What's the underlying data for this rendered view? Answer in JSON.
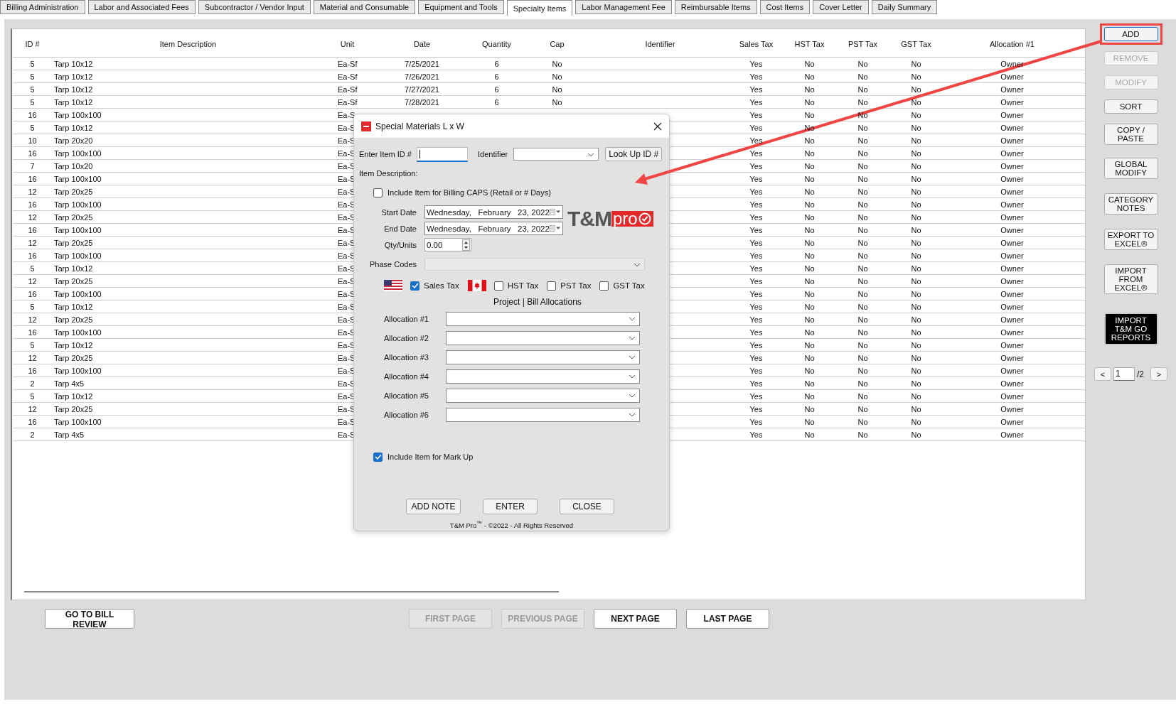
{
  "tabs": [
    {
      "label": "Billing Administration",
      "selected": false
    },
    {
      "label": "Labor and Associated Fees",
      "selected": false
    },
    {
      "label": "Subcontractor / Vendor Input",
      "selected": false
    },
    {
      "label": "Material and Consumable",
      "selected": false
    },
    {
      "label": "Equipment and Tools",
      "selected": false
    },
    {
      "label": "Specialty Items",
      "selected": true
    },
    {
      "label": "Labor Management Fee",
      "selected": false
    },
    {
      "label": "Reimbursable Items",
      "selected": false
    },
    {
      "label": "Cost Items",
      "selected": false
    },
    {
      "label": "Cover Letter",
      "selected": false
    },
    {
      "label": "Daily Summary",
      "selected": false
    }
  ],
  "table": {
    "columns": [
      "ID #",
      "Item Description",
      "Unit",
      "Date",
      "Quantity",
      "Cap",
      "Identifier",
      "Sales Tax",
      "HST Tax",
      "PST Tax",
      "GST Tax",
      "Allocation #1"
    ],
    "rows": [
      {
        "id": "5",
        "description": "Tarp 10x12",
        "unit": "Ea-Sf",
        "date": "7/25/2021",
        "quantity": "6",
        "cap": "No",
        "sales_tax": "Yes",
        "hst_tax": "No",
        "pst_tax": "No",
        "gst_tax": "No",
        "allocation_1": "Owner"
      },
      {
        "id": "5",
        "description": "Tarp 10x12",
        "unit": "Ea-Sf",
        "date": "7/26/2021",
        "quantity": "6",
        "cap": "No",
        "sales_tax": "Yes",
        "hst_tax": "No",
        "pst_tax": "No",
        "gst_tax": "No",
        "allocation_1": "Owner"
      },
      {
        "id": "5",
        "description": "Tarp 10x12",
        "unit": "Ea-Sf",
        "date": "7/27/2021",
        "quantity": "6",
        "cap": "No",
        "sales_tax": "Yes",
        "hst_tax": "No",
        "pst_tax": "No",
        "gst_tax": "No",
        "allocation_1": "Owner"
      },
      {
        "id": "5",
        "description": "Tarp 10x12",
        "unit": "Ea-Sf",
        "date": "7/28/2021",
        "quantity": "6",
        "cap": "No",
        "sales_tax": "Yes",
        "hst_tax": "No",
        "pst_tax": "No",
        "gst_tax": "No",
        "allocation_1": "Owner"
      },
      {
        "id": "16",
        "description": "Tarp 100x100",
        "unit": "Ea-S",
        "sales_tax": "Yes",
        "hst_tax": "No",
        "pst_tax": "No",
        "gst_tax": "No",
        "allocation_1": "Owner"
      },
      {
        "id": "5",
        "description": "Tarp 10x12",
        "unit": "Ea-S",
        "sales_tax": "Yes",
        "hst_tax": "No",
        "pst_tax": "No",
        "gst_tax": "No",
        "allocation_1": "Owner"
      },
      {
        "id": "10",
        "description": "Tarp 20x20",
        "unit": "Ea-S",
        "sales_tax": "Yes",
        "hst_tax": "No",
        "pst_tax": "No",
        "gst_tax": "No",
        "allocation_1": "Owner"
      },
      {
        "id": "16",
        "description": "Tarp 100x100",
        "unit": "Ea-S",
        "sales_tax": "Yes",
        "hst_tax": "No",
        "pst_tax": "No",
        "gst_tax": "No",
        "allocation_1": "Owner"
      },
      {
        "id": "7",
        "description": "Tarp 10x20",
        "unit": "Ea-S",
        "sales_tax": "Yes",
        "hst_tax": "No",
        "pst_tax": "No",
        "gst_tax": "No",
        "allocation_1": "Owner"
      },
      {
        "id": "16",
        "description": "Tarp 100x100",
        "unit": "Ea-S",
        "sales_tax": "Yes",
        "hst_tax": "No",
        "pst_tax": "No",
        "gst_tax": "No",
        "allocation_1": "Owner"
      },
      {
        "id": "12",
        "description": "Tarp 20x25",
        "unit": "Ea-S",
        "sales_tax": "Yes",
        "hst_tax": "No",
        "pst_tax": "No",
        "gst_tax": "No",
        "allocation_1": "Owner"
      },
      {
        "id": "16",
        "description": "Tarp 100x100",
        "unit": "Ea-S",
        "sales_tax": "Yes",
        "hst_tax": "No",
        "pst_tax": "No",
        "gst_tax": "No",
        "allocation_1": "Owner"
      },
      {
        "id": "12",
        "description": "Tarp 20x25",
        "unit": "Ea-S",
        "sales_tax": "Yes",
        "hst_tax": "No",
        "pst_tax": "No",
        "gst_tax": "No",
        "allocation_1": "Owner"
      },
      {
        "id": "16",
        "description": "Tarp 100x100",
        "unit": "Ea-S",
        "sales_tax": "Yes",
        "hst_tax": "No",
        "pst_tax": "No",
        "gst_tax": "No",
        "allocation_1": "Owner"
      },
      {
        "id": "12",
        "description": "Tarp 20x25",
        "unit": "Ea-S",
        "sales_tax": "Yes",
        "hst_tax": "No",
        "pst_tax": "No",
        "gst_tax": "No",
        "allocation_1": "Owner"
      },
      {
        "id": "16",
        "description": "Tarp 100x100",
        "unit": "Ea-S",
        "sales_tax": "Yes",
        "hst_tax": "No",
        "pst_tax": "No",
        "gst_tax": "No",
        "allocation_1": "Owner"
      },
      {
        "id": "5",
        "description": "Tarp 10x12",
        "unit": "Ea-S",
        "sales_tax": "Yes",
        "hst_tax": "No",
        "pst_tax": "No",
        "gst_tax": "No",
        "allocation_1": "Owner"
      },
      {
        "id": "12",
        "description": "Tarp 20x25",
        "unit": "Ea-S",
        "sales_tax": "Yes",
        "hst_tax": "No",
        "pst_tax": "No",
        "gst_tax": "No",
        "allocation_1": "Owner"
      },
      {
        "id": "16",
        "description": "Tarp 100x100",
        "unit": "Ea-S",
        "sales_tax": "Yes",
        "hst_tax": "No",
        "pst_tax": "No",
        "gst_tax": "No",
        "allocation_1": "Owner"
      },
      {
        "id": "5",
        "description": "Tarp 10x12",
        "unit": "Ea-S",
        "sales_tax": "Yes",
        "hst_tax": "No",
        "pst_tax": "No",
        "gst_tax": "No",
        "allocation_1": "Owner"
      },
      {
        "id": "12",
        "description": "Tarp 20x25",
        "unit": "Ea-S",
        "sales_tax": "Yes",
        "hst_tax": "No",
        "pst_tax": "No",
        "gst_tax": "No",
        "allocation_1": "Owner"
      },
      {
        "id": "16",
        "description": "Tarp 100x100",
        "unit": "Ea-S",
        "sales_tax": "Yes",
        "hst_tax": "No",
        "pst_tax": "No",
        "gst_tax": "No",
        "allocation_1": "Owner"
      },
      {
        "id": "5",
        "description": "Tarp 10x12",
        "unit": "Ea-S",
        "sales_tax": "Yes",
        "hst_tax": "No",
        "pst_tax": "No",
        "gst_tax": "No",
        "allocation_1": "Owner"
      },
      {
        "id": "12",
        "description": "Tarp 20x25",
        "unit": "Ea-S",
        "sales_tax": "Yes",
        "hst_tax": "No",
        "pst_tax": "No",
        "gst_tax": "No",
        "allocation_1": "Owner"
      },
      {
        "id": "16",
        "description": "Tarp 100x100",
        "unit": "Ea-S",
        "sales_tax": "Yes",
        "hst_tax": "No",
        "pst_tax": "No",
        "gst_tax": "No",
        "allocation_1": "Owner"
      },
      {
        "id": "2",
        "description": "Tarp 4x5",
        "unit": "Ea-S",
        "sales_tax": "Yes",
        "hst_tax": "No",
        "pst_tax": "No",
        "gst_tax": "No",
        "allocation_1": "Owner"
      },
      {
        "id": "5",
        "description": "Tarp 10x12",
        "unit": "Ea-S",
        "sales_tax": "Yes",
        "hst_tax": "No",
        "pst_tax": "No",
        "gst_tax": "No",
        "allocation_1": "Owner"
      },
      {
        "id": "12",
        "description": "Tarp 20x25",
        "unit": "Ea-S",
        "sales_tax": "Yes",
        "hst_tax": "No",
        "pst_tax": "No",
        "gst_tax": "No",
        "allocation_1": "Owner"
      },
      {
        "id": "16",
        "description": "Tarp 100x100",
        "unit": "Ea-S",
        "sales_tax": "Yes",
        "hst_tax": "No",
        "pst_tax": "No",
        "gst_tax": "No",
        "allocation_1": "Owner"
      },
      {
        "id": "2",
        "description": "Tarp 4x5",
        "unit": "Ea-S",
        "sales_tax": "Yes",
        "hst_tax": "No",
        "pst_tax": "No",
        "gst_tax": "No",
        "allocation_1": "Owner"
      }
    ]
  },
  "side_buttons": [
    {
      "lines": [
        "ADD"
      ],
      "kind": "normal",
      "disabled": false,
      "highlighted": true
    },
    {
      "lines": [
        "REMOVE"
      ],
      "kind": "normal",
      "disabled": true,
      "highlighted": false
    },
    {
      "lines": [
        "MODIFY"
      ],
      "kind": "normal",
      "disabled": true,
      "highlighted": false
    },
    {
      "lines": [
        "SORT"
      ],
      "kind": "normal",
      "disabled": false,
      "highlighted": false
    },
    {
      "lines": [
        "COPY /",
        "PASTE"
      ],
      "kind": "normal",
      "disabled": false,
      "highlighted": false
    },
    {
      "lines": [
        "GLOBAL",
        "MODIFY"
      ],
      "kind": "normal",
      "disabled": false,
      "highlighted": false
    },
    {
      "lines": [
        "CATEGORY",
        "NOTES"
      ],
      "kind": "normal",
      "disabled": false,
      "highlighted": false
    },
    {
      "lines": [
        "EXPORT TO",
        "EXCEL®"
      ],
      "kind": "normal",
      "disabled": false,
      "highlighted": false
    },
    {
      "lines": [
        "IMPORT",
        "FROM",
        "EXCEL®"
      ],
      "kind": "normal",
      "disabled": false,
      "highlighted": false
    },
    {
      "lines": [
        "IMPORT",
        "T&M GO",
        "REPORTS"
      ],
      "kind": "dark",
      "disabled": false,
      "highlighted": false
    }
  ],
  "pager": {
    "prev": "<",
    "page": "1",
    "total": "/2",
    "next": ">"
  },
  "bill_review_button": "GO TO BILL REVIEW",
  "nav_buttons": [
    {
      "label": "FIRST PAGE",
      "disabled": true
    },
    {
      "label": "PREVIOUS PAGE",
      "disabled": true
    },
    {
      "label": "NEXT PAGE",
      "disabled": false
    },
    {
      "label": "LAST PAGE",
      "disabled": false
    }
  ],
  "dialog": {
    "title": "Special Materials L x W",
    "item_id_label": "Enter Item ID #",
    "identifier_label": "Identifier",
    "lookup_button": "Look Up ID #",
    "description_label": "Item Description:",
    "billing_caps": {
      "label": "Include Item for Billing CAPS (Retail or # Days)",
      "checked": false
    },
    "dates": [
      {
        "label": "Start Date",
        "value": "Wednesday,   February   23, 2022"
      },
      {
        "label": "End Date",
        "value": "Wednesday,   February   23, 2022"
      }
    ],
    "logo": {
      "text": "T&M",
      "badge": "pro"
    },
    "qty": {
      "label": "Qty/Units",
      "value": "0.00"
    },
    "phase_codes": {
      "label": "Phase Codes",
      "disabled": true
    },
    "taxes": [
      {
        "label": "Sales Tax",
        "checked": true,
        "kind": "us-flag"
      },
      {
        "label": "HST Tax",
        "checked": false,
        "kind": "ca-flag"
      },
      {
        "label": "PST Tax",
        "checked": false,
        "kind": "plain"
      },
      {
        "label": "GST Tax",
        "checked": false,
        "kind": "plain"
      }
    ],
    "allocations_heading": "Project | Bill Allocations",
    "allocations": [
      {
        "label": "Allocation #1"
      },
      {
        "label": "Allocation #2"
      },
      {
        "label": "Allocation #3"
      },
      {
        "label": "Allocation #4"
      },
      {
        "label": "Allocation #5"
      },
      {
        "label": "Allocation #6"
      }
    ],
    "mark_up": {
      "label": "Include Item for Mark Up",
      "checked": true
    },
    "buttons": [
      "ADD NOTE",
      "ENTER",
      "CLOSE"
    ],
    "footer": "T&M Pro$^{™}$ - ©2022 - All Rights Reserved"
  }
}
